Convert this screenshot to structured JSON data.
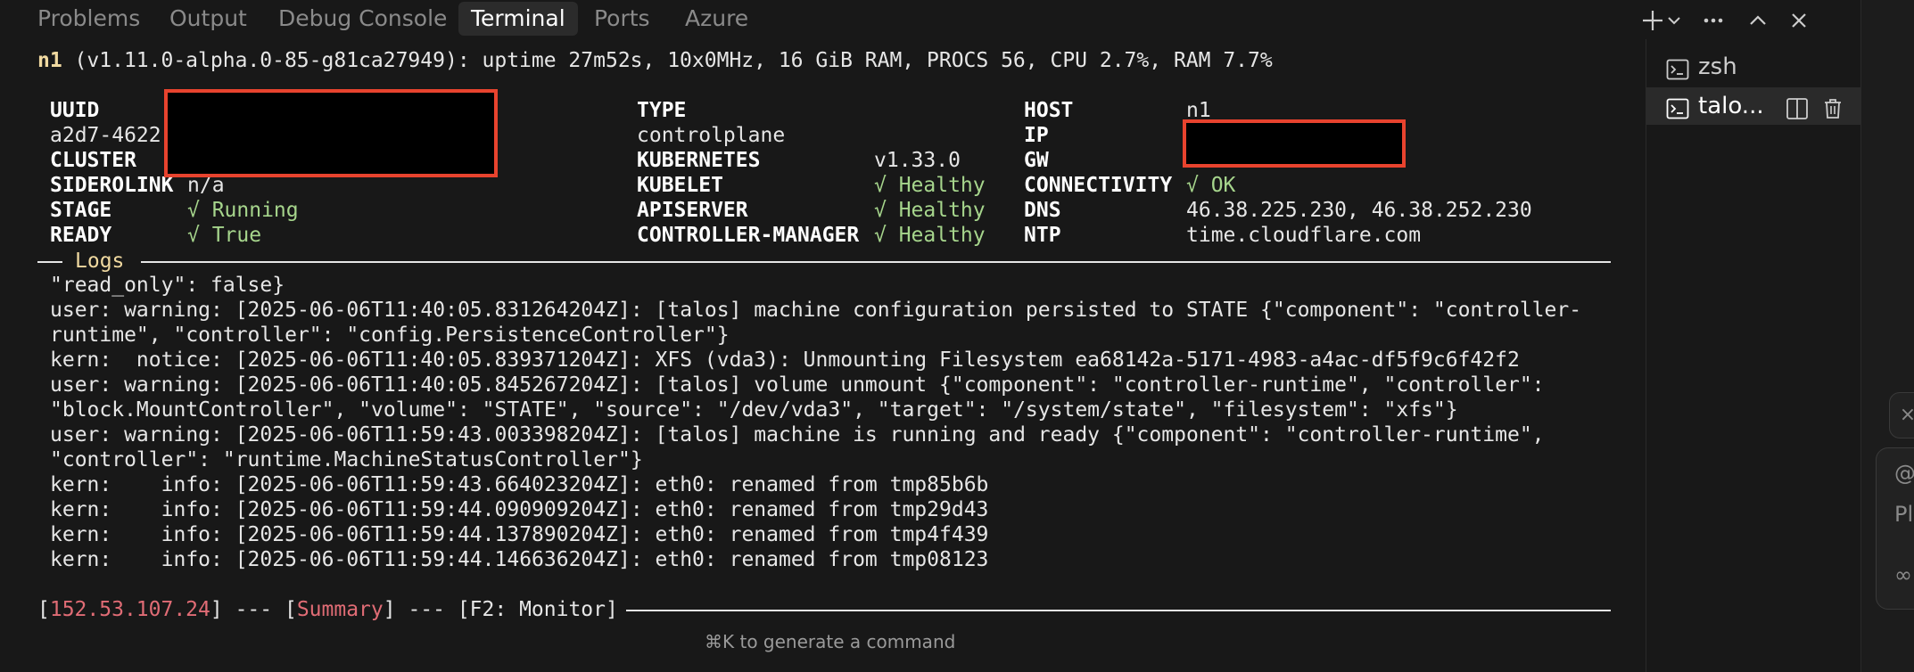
{
  "panel_tabs": [
    {
      "label": "Problems"
    },
    {
      "label": "Output"
    },
    {
      "label": "Debug Console"
    },
    {
      "label": "Terminal"
    },
    {
      "label": "Ports"
    },
    {
      "label": "Azure"
    }
  ],
  "active_tab": "Terminal",
  "header": {
    "node": "n1",
    "rest": " (v1.11.0-alpha.0-85-g81ca27949): uptime 27m52s, 10x0MHz, 16 GiB RAM, PROCS 56, CPU 2.7%, RAM 7.7%"
  },
  "node_info": {
    "uuid_label": "UUID",
    "uuid_value": "a2d7-4622",
    "cluster_label": "CLUSTER",
    "siderolink_label": "SIDEROLINK",
    "siderolink_value": "n/a",
    "stage_label": "STAGE",
    "stage_value": "√ Running",
    "ready_label": "READY",
    "ready_value": "√ True",
    "type_label": "TYPE",
    "type_value": "controlplane",
    "kubernetes_label": "KUBERNETES",
    "kubernetes_value": "v1.33.0",
    "kubelet_label": "KUBELET",
    "kubelet_value": "√ Healthy",
    "apiserver_label": "APISERVER",
    "apiserver_value": "√ Healthy",
    "cm_label": "CONTROLLER-MANAGER",
    "cm_value": "√ Healthy",
    "host_label": "HOST",
    "host_value": "n1",
    "ip_label": "IP",
    "gw_label": "GW",
    "connectivity_label": "CONNECTIVITY",
    "connectivity_value": "√ OK",
    "dns_label": "DNS",
    "dns_value": "46.38.225.230, 46.38.252.230",
    "ntp_label": "NTP",
    "ntp_value": "time.cloudflare.com"
  },
  "logs_title": "Logs",
  "log_lines": [
    "\"read_only\": false}",
    "user: warning: [2025-06-06T11:40:05.831264204Z]: [talos] machine configuration persisted to STATE {\"component\": \"controller-",
    "runtime\", \"controller\": \"config.PersistenceController\"}",
    "kern:  notice: [2025-06-06T11:40:05.839371204Z]: XFS (vda3): Unmounting Filesystem ea68142a-5171-4983-a4ac-df5f9c6f42f2",
    "user: warning: [2025-06-06T11:40:05.845267204Z]: [talos] volume unmount {\"component\": \"controller-runtime\", \"controller\":",
    "\"block.MountController\", \"volume\": \"STATE\", \"source\": \"/dev/vda3\", \"target\": \"/system/state\", \"filesystem\": \"xfs\"}",
    "user: warning: [2025-06-06T11:59:43.003398204Z]: [talos] machine is running and ready {\"component\": \"controller-runtime\",",
    "\"controller\": \"runtime.MachineStatusController\"}",
    "kern:    info: [2025-06-06T11:59:43.664023204Z]: eth0: renamed from tmp85b6b",
    "kern:    info: [2025-06-06T11:59:44.090909204Z]: eth0: renamed from tmp29d43",
    "kern:    info: [2025-06-06T11:59:44.137890204Z]: eth0: renamed from tmp4f439",
    "kern:    info: [2025-06-06T11:59:44.146636204Z]: eth0: renamed from tmp08123"
  ],
  "footer": {
    "open1": "[",
    "ip": "152.53.107.24",
    "sep1": "] --- [",
    "summary": "Summary",
    "sep2": "] --- [F2: Monitor]"
  },
  "hint": "⌘K to generate a command",
  "sessions": [
    {
      "label": "zsh"
    },
    {
      "label": "talo..."
    }
  ],
  "edge_texts": {
    "chip": "×",
    "card_at": "@",
    "card_pl": "Pl",
    "card_inf": "∞"
  },
  "colors": {
    "background": "#181818",
    "green": "#a6d58c",
    "amber": "#f0d9a0",
    "footer_red": "#e06c75",
    "redaction_border": "#e8432e"
  }
}
